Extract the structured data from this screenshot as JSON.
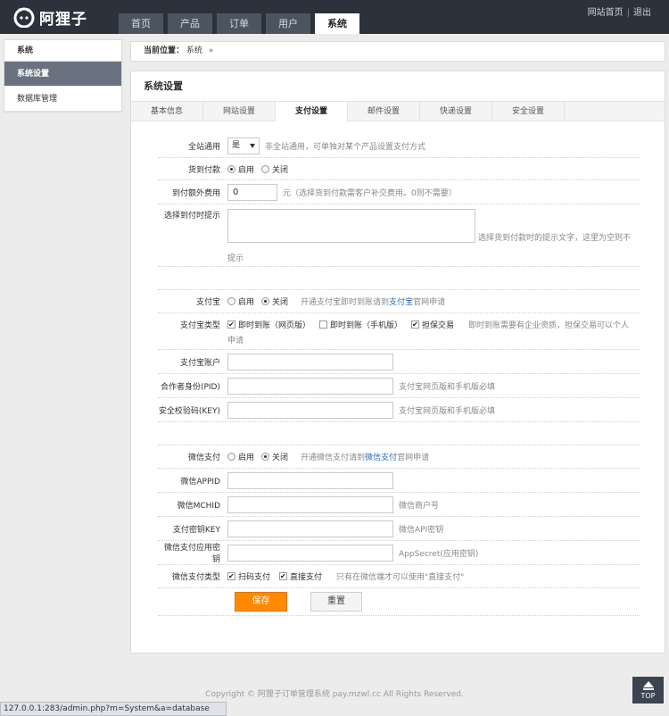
{
  "brand": {
    "name": "阿狸子"
  },
  "nav": {
    "items": [
      "首页",
      "产品",
      "订单",
      "用户",
      "系统"
    ],
    "active": 4
  },
  "toplinks": {
    "home": "网站首页",
    "sep": "|",
    "logout": "退出"
  },
  "sidebar": {
    "title": "系统",
    "items": [
      {
        "label": "系统设置",
        "active": true
      },
      {
        "label": "数据库管理",
        "active": false
      }
    ]
  },
  "breadcrumb": {
    "prefix": "当前位置：",
    "current": "系统",
    "arrow": "»"
  },
  "panel": {
    "title": "系统设置"
  },
  "tabs": [
    "基本信息",
    "网站设置",
    "支付设置",
    "邮件设置",
    "快递设置",
    "安全设置"
  ],
  "form": {
    "site_general": {
      "label": "全站通用",
      "value": "是",
      "hint": "非全站通用，可单独对某个产品设置支付方式"
    },
    "cod": {
      "label": "货到付款",
      "on": "启用",
      "off": "关闭"
    },
    "cod_fee": {
      "label": "到付额外费用",
      "value": "0",
      "hint": "元（选择货到付款需客户补交费用。0则不需要）"
    },
    "cod_tip": {
      "label": "选择到付时提示",
      "hint1": "选择货到付款时的提示文字，这里为空则不",
      "hint2": "提示"
    },
    "alipay": {
      "label": "支付宝",
      "on": "启用",
      "off": "关闭",
      "hint_pre": "开通支付宝即时到账请到",
      "hint_link": "支付宝",
      "hint_post": "官网申请"
    },
    "alipay_type": {
      "label": "支付宝类型",
      "opt1": "即时到账（网页版）",
      "opt2": "即时到账（手机版）",
      "opt3": "担保交易",
      "hint1": "即时到账需要有企业资质，担保交易可以个人",
      "hint2": "申请"
    },
    "alipay_account": {
      "label": "支付宝账户"
    },
    "alipay_pid": {
      "label": "合作者身份(PID)",
      "hint": "支付宝网页版和手机版必填"
    },
    "alipay_key": {
      "label": "安全校验码(KEY)",
      "hint": "支付宝网页版和手机版必填"
    },
    "wxpay": {
      "label": "微信支付",
      "on": "启用",
      "off": "关闭",
      "hint_pre": "开通微信支付请到",
      "hint_link": "微信支付",
      "hint_post": "官网申请"
    },
    "wx_appid": {
      "label": "微信APPID"
    },
    "wx_mchid": {
      "label": "微信MCHID",
      "hint": "微信商户号"
    },
    "wx_key": {
      "label": "支付密钥KEY",
      "hint": "微信API密钥"
    },
    "wx_secret": {
      "label": "微信支付应用密钥",
      "hint": "AppSecret(应用密钥)"
    },
    "wx_type": {
      "label": "微信支付类型",
      "opt1": "扫码支付",
      "opt2": "直接支付",
      "hint": "只有在微信端才可以使用\"直接支付\""
    },
    "save": "保存",
    "reset": "重置"
  },
  "footer": {
    "text": "Copyright © 阿狸子订单管理系统 pay.mzwl.cc  All Rights Reserved."
  },
  "top_button": "TOP",
  "status_url": "127.0.0.1:283/admin.php?m=System&a=database",
  "colors": {
    "topbar": "#2b323b",
    "accent": "#ff8a00",
    "link": "#2d6cb5"
  }
}
